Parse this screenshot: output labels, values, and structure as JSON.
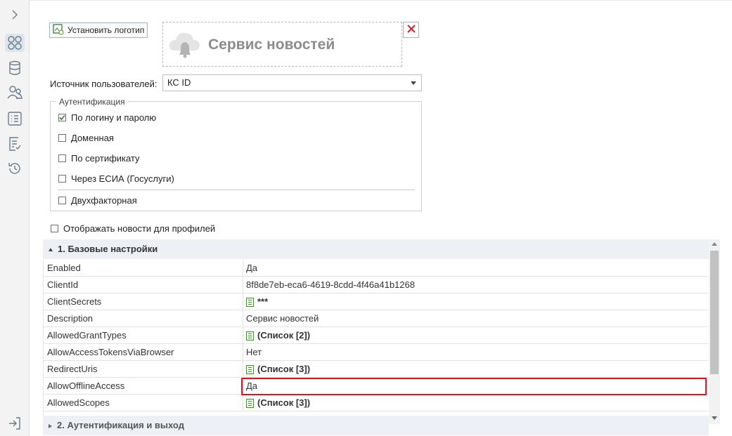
{
  "logo": {
    "set_logo_label": "Установить логотип",
    "service_name": "Сервис новостей"
  },
  "user_source": {
    "label": "Источник пользователей:",
    "selected": "КС ID"
  },
  "auth": {
    "legend": "Аутентификация",
    "options": [
      {
        "label": "По логину и паролю",
        "checked": true
      },
      {
        "label": "Доменная",
        "checked": false
      },
      {
        "label": "По сертификату",
        "checked": false
      },
      {
        "label": "Через ЕСИА (Госуслуги)",
        "checked": false
      }
    ],
    "two_factor": {
      "label": "Двухфакторная",
      "checked": false
    }
  },
  "show_news_for_profiles": {
    "label": "Отображать новости для профилей",
    "checked": false
  },
  "property_grid": {
    "category_1": "1. Базовые настройки",
    "category_2": "2. Аутентификация и выход",
    "rows": [
      {
        "key": "Enabled",
        "value": "Да",
        "editor_icon": false,
        "bold": false
      },
      {
        "key": "ClientId",
        "value": "8f8de7eb-eca6-4619-8cdd-4f46a41b1268",
        "editor_icon": false,
        "bold": false
      },
      {
        "key": "ClientSecrets",
        "value": "***",
        "editor_icon": true,
        "bold": true
      },
      {
        "key": "Description",
        "value": "Сервис новостей",
        "editor_icon": false,
        "bold": false
      },
      {
        "key": "AllowedGrantTypes",
        "value": "(Список [2])",
        "editor_icon": true,
        "bold": true
      },
      {
        "key": "AllowAccessTokensViaBrowser",
        "value": "Нет",
        "editor_icon": false,
        "bold": false
      },
      {
        "key": "RedirectUris",
        "value": "(Список [3])",
        "editor_icon": true,
        "bold": true
      },
      {
        "key": "AllowOfflineAccess",
        "value": "Да",
        "editor_icon": false,
        "bold": false
      },
      {
        "key": "AllowedScopes",
        "value": "(Список [3])",
        "editor_icon": true,
        "bold": true
      }
    ]
  },
  "nav_icons": [
    "chevron-right-icon",
    "dashboard-icon",
    "database-icon",
    "users-icon",
    "list-icon",
    "checklist-icon",
    "history-icon",
    "logout-icon"
  ],
  "colors": {
    "highlight": "#e0141e",
    "category_bg": "#edf1f5"
  }
}
